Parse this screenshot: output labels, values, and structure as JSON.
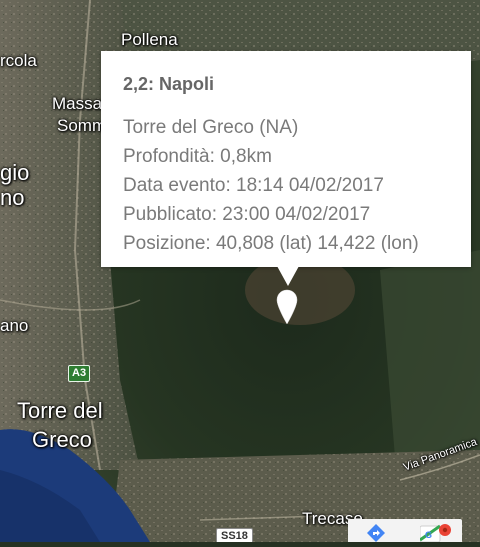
{
  "info_window": {
    "title": "2,2: Napoli",
    "lines": [
      "Torre del Greco (NA)",
      "Profondità: 0,8km",
      "Data evento: 18:14 04/02/2017",
      "Pubblicato: 23:00 04/02/2017",
      "Posizione: 40,808 (lat) 14,422 (lon)"
    ]
  },
  "map": {
    "labels": {
      "pollena": "Pollena",
      "ercolano_fragment": "rcola",
      "massa_fragment": "Massa",
      "somma_fragment": "Somm",
      "giorgio_fragment": "gio",
      "no_fragment_1": "no",
      "no_fragment_2": "ano",
      "torre_del": "Torre del",
      "greco": "Greco",
      "via_panoramica": "Via Panoramica",
      "trecase": "Trecase"
    },
    "shields": {
      "a3": "A3",
      "ss18": "SS18"
    }
  },
  "controls": {
    "directions_icon": "directions-icon",
    "google_maps_icon": "google-maps-icon"
  },
  "colors": {
    "marker": "#ffffff",
    "sea": "#1c3b7a",
    "vegetation": "#2c3a26"
  }
}
